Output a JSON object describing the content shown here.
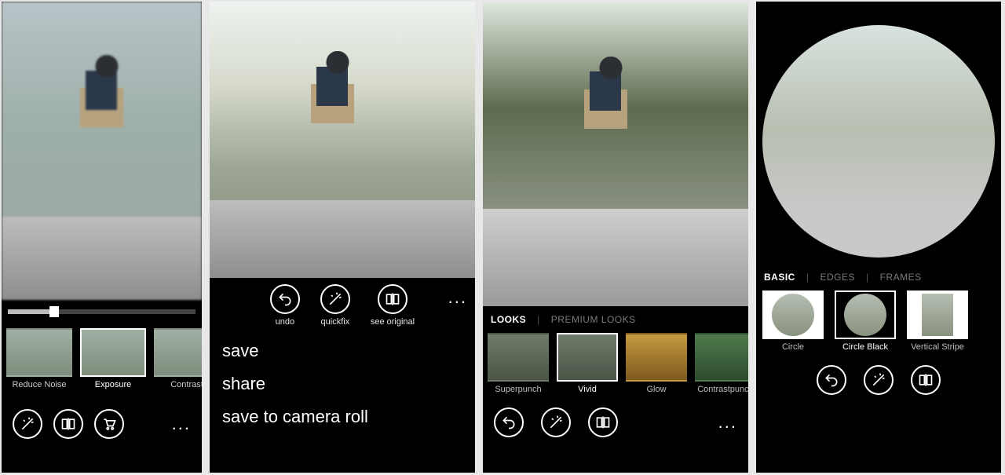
{
  "screen1": {
    "slider_value": 22,
    "thumbs": [
      {
        "label": "Reduce Noise"
      },
      {
        "label": "Exposure"
      },
      {
        "label": "Contrast"
      }
    ],
    "toolbar": {
      "quickfix": "quickfix",
      "compare": "see original",
      "shop": "shop",
      "more": "..."
    }
  },
  "screen2": {
    "actions": {
      "undo": "undo",
      "quickfix": "quickfix",
      "see_original": "see original",
      "more": "..."
    },
    "menu": [
      "save",
      "share",
      "save to camera roll"
    ]
  },
  "screen3": {
    "tabs": {
      "looks": "LOOKS",
      "premium": "PREMIUM LOOKS"
    },
    "active_tab": "looks",
    "looks": [
      {
        "label": "Superpunch"
      },
      {
        "label": "Vivid",
        "selected": true
      },
      {
        "label": "Glow"
      },
      {
        "label": "Contrastpunch"
      }
    ],
    "toolbar": {
      "undo": "undo",
      "quickfix": "quickfix",
      "compare": "see original",
      "more": "..."
    }
  },
  "screen4": {
    "tabs": {
      "basic": "BASIC",
      "edges": "EDGES",
      "frames": "FRAMES"
    },
    "active_tab": "basic",
    "frames": [
      {
        "label": "Circle"
      },
      {
        "label": "Circle Black",
        "selected": true
      },
      {
        "label": "Vertical Stripe"
      }
    ],
    "toolbar": {
      "undo": "undo",
      "quickfix": "quickfix",
      "compare": "see original"
    }
  },
  "icons": {
    "undo": "undo-icon",
    "wand": "wand-icon",
    "compare": "compare-icon",
    "cart": "cart-icon"
  }
}
